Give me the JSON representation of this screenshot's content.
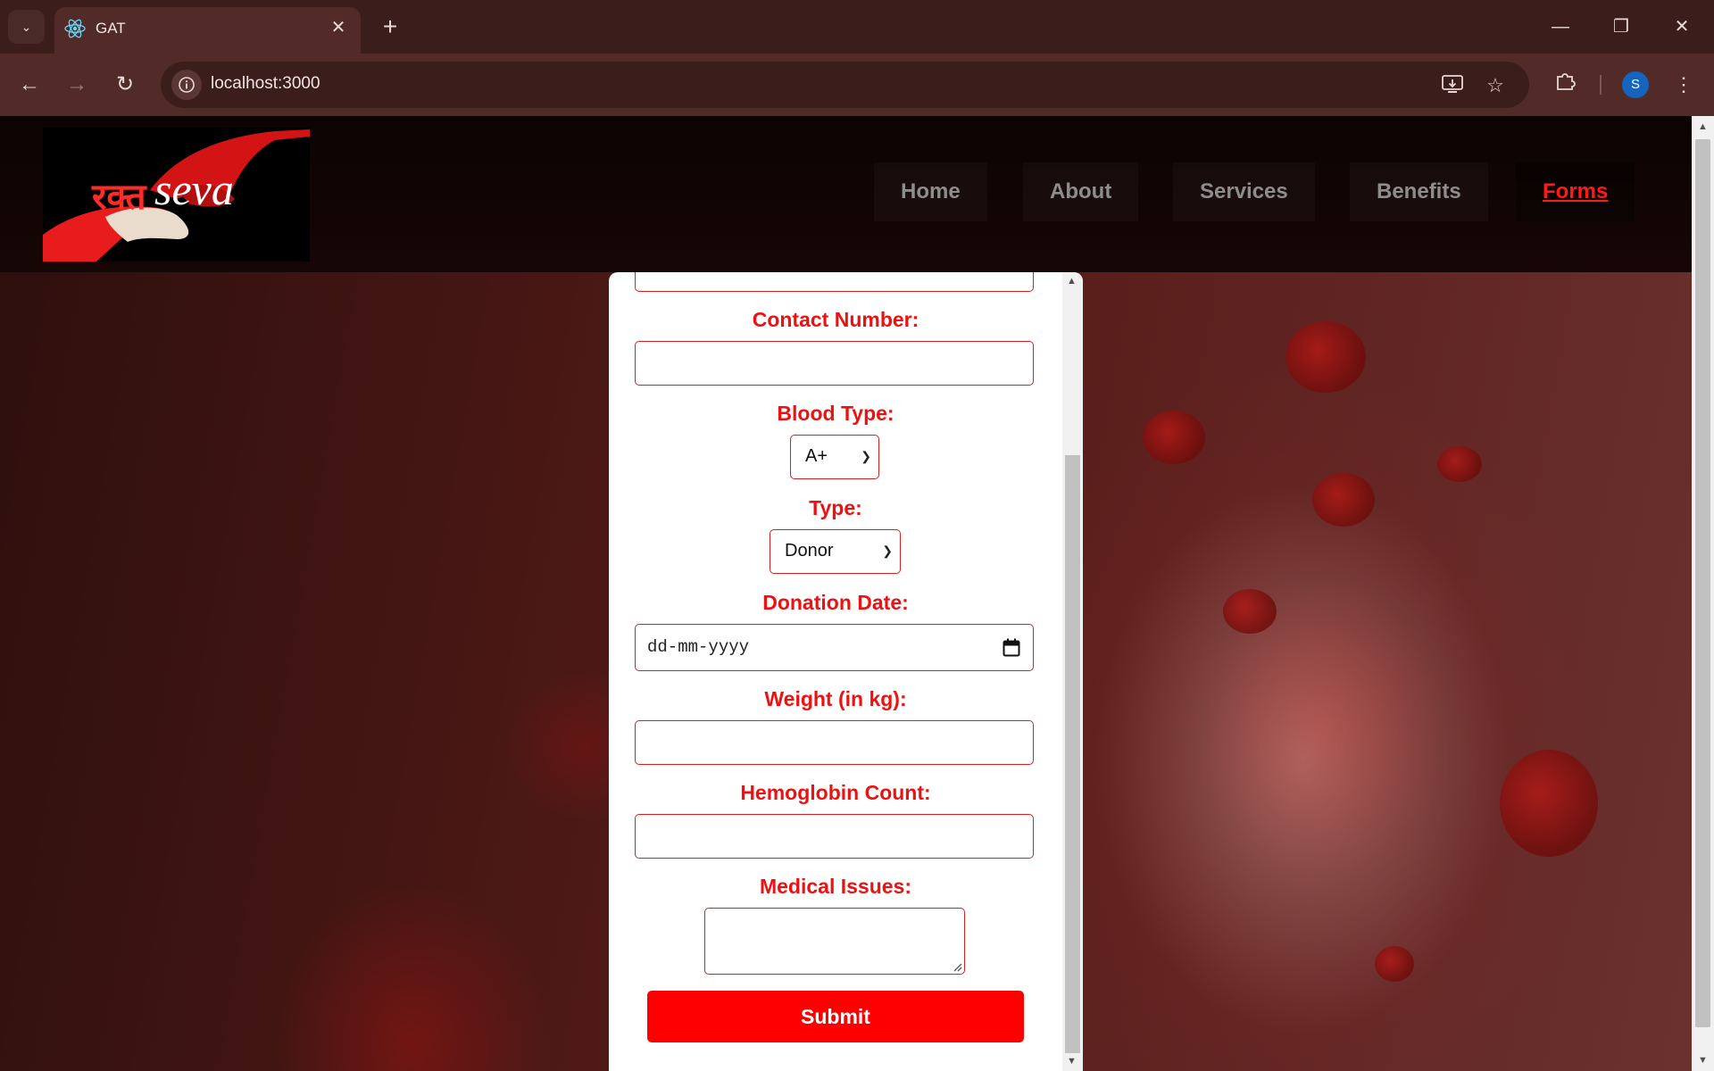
{
  "browser": {
    "tab_title": "GAT",
    "url": "localhost:3000",
    "profile_initial": "S"
  },
  "site": {
    "logo_text_devanagari": "रक्त",
    "logo_text_latin": "seva",
    "nav": [
      {
        "label": "Home"
      },
      {
        "label": "About"
      },
      {
        "label": "Services"
      },
      {
        "label": "Benefits"
      },
      {
        "label": "Forms",
        "active": true
      }
    ]
  },
  "form": {
    "contact_label": "Contact Number:",
    "contact_value": "",
    "blood_type_label": "Blood Type:",
    "blood_type_value": "A+",
    "type_label": "Type:",
    "type_value": "Donor",
    "donation_date_label": "Donation Date:",
    "donation_date_placeholder": "dd-mm-yyyy",
    "weight_label": "Weight (in kg):",
    "weight_value": "",
    "hemoglobin_label": "Hemoglobin Count:",
    "hemoglobin_value": "",
    "medical_issues_label": "Medical Issues:",
    "medical_issues_value": "",
    "submit_label": "Submit"
  },
  "colors": {
    "accent": "#ff0000",
    "label": "#ee1111",
    "nav_active": "#ff1a1a"
  }
}
